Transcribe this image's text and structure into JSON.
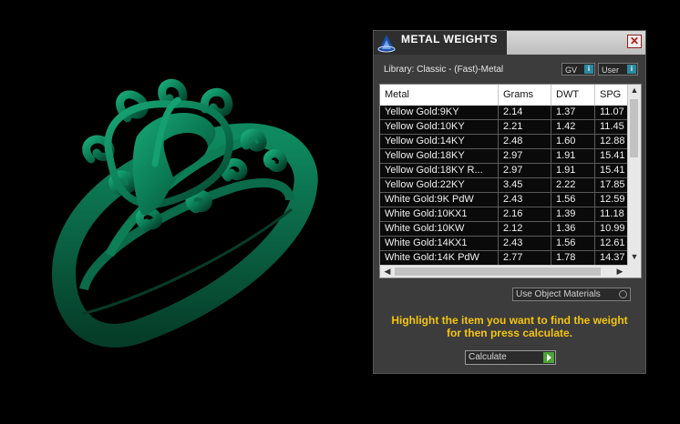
{
  "dialog": {
    "title": "METAL WEIGHTS",
    "close_glyph": "✕",
    "library_label": "Library: Classic - (Fast)-Metal",
    "chips": [
      {
        "label": "GV",
        "info": "i"
      },
      {
        "label": "User",
        "info": "i"
      }
    ],
    "table": {
      "columns": [
        "Metal",
        "Grams",
        "DWT",
        "SPG"
      ],
      "rows": [
        [
          "Yellow Gold:9KY",
          "2.14",
          "1.37",
          "11.07"
        ],
        [
          "Yellow Gold:10KY",
          "2.21",
          "1.42",
          "11.45"
        ],
        [
          "Yellow Gold:14KY",
          "2.48",
          "1.60",
          "12.88"
        ],
        [
          "Yellow Gold:18KY",
          "2.97",
          "1.91",
          "15.41"
        ],
        [
          "Yellow Gold:18KY R...",
          "2.97",
          "1.91",
          "15.41"
        ],
        [
          "Yellow Gold:22KY",
          "3.45",
          "2.22",
          "17.85"
        ],
        [
          "White Gold:9K PdW",
          "2.43",
          "1.56",
          "12.59"
        ],
        [
          "White Gold:10KX1",
          "2.16",
          "1.39",
          "11.18"
        ],
        [
          "White Gold:10KW",
          "2.12",
          "1.36",
          "10.99"
        ],
        [
          "White Gold:14KX1",
          "2.43",
          "1.56",
          "12.61"
        ],
        [
          "White Gold:14K PdW",
          "2.77",
          "1.78",
          "14.37"
        ]
      ],
      "scroll_arrows": {
        "up": "▲",
        "down": "▼",
        "left": "◀",
        "right": "▶"
      }
    },
    "use_object_materials": "Use Object Materials",
    "hint_line1": "Highlight the item you want to find the weight",
    "hint_line2": "for then press calculate.",
    "calculate_label": "Calculate"
  },
  "colors": {
    "ring": "#0b7a55",
    "hint": "#f4c40f",
    "go_button": "#4da23a"
  }
}
